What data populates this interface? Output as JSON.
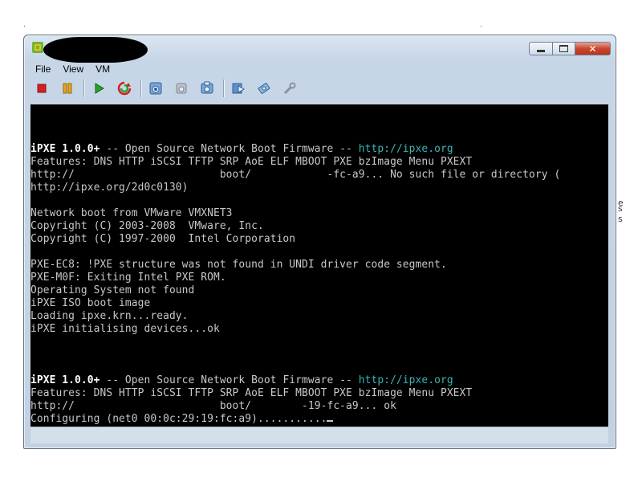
{
  "window": {
    "title_redacted": true,
    "controls": {
      "minimize": "minimize",
      "maximize": "maximize",
      "close": "✕"
    }
  },
  "menu": {
    "items": [
      "File",
      "View",
      "VM"
    ]
  },
  "toolbar": {
    "groups": [
      [
        {
          "name": "stop-icon",
          "color": "#d22020"
        },
        {
          "name": "pause-icon",
          "color": "#e09a10"
        }
      ],
      [
        {
          "name": "play-icon",
          "color": "#2aa12a"
        },
        {
          "name": "reset-icon",
          "color": "#cc2222"
        }
      ],
      [
        {
          "name": "snapshot-icon"
        },
        {
          "name": "revert-icon"
        },
        {
          "name": "snapshot-manager-icon"
        }
      ],
      [
        {
          "name": "ctrl-alt-del-icon"
        },
        {
          "name": "settings-icon"
        },
        {
          "name": "tools-icon"
        }
      ]
    ]
  },
  "console": {
    "lines": [
      {
        "row": 0,
        "segments": [
          {
            "text": "iPXE 1.0.0+",
            "style": "hl"
          },
          {
            "text": " -- Open Source Network Boot Firmware -- "
          },
          {
            "text": "http://ipxe.org",
            "style": "link"
          }
        ]
      },
      {
        "row": 1,
        "segments": [
          {
            "text": "Features: DNS HTTP iSCSI TFTP SRP AoE ELF MBOOT PXE bzImage Menu PXEXT"
          }
        ]
      },
      {
        "row": 2,
        "segments": [
          {
            "text": "http://                       boot/            -fc-a9... No such file or directory ("
          }
        ]
      },
      {
        "row": 3,
        "segments": [
          {
            "text": "http://ipxe.org/2d0c0130)"
          }
        ]
      },
      {
        "row": 5,
        "segments": [
          {
            "text": "Network boot from VMware VMXNET3"
          }
        ]
      },
      {
        "row": 6,
        "segments": [
          {
            "text": "Copyright (C) 2003-2008  VMware, Inc."
          }
        ]
      },
      {
        "row": 7,
        "segments": [
          {
            "text": "Copyright (C) 1997-2000  Intel Corporation"
          }
        ]
      },
      {
        "row": 9,
        "segments": [
          {
            "text": "PXE-EC8: !PXE structure was not found in UNDI driver code segment."
          }
        ]
      },
      {
        "row": 10,
        "segments": [
          {
            "text": "PXE-M0F: Exiting Intel PXE ROM."
          }
        ]
      },
      {
        "row": 11,
        "segments": [
          {
            "text": "Operating System not found"
          }
        ]
      },
      {
        "row": 12,
        "segments": [
          {
            "text": "iPXE ISO boot image"
          }
        ]
      },
      {
        "row": 13,
        "segments": [
          {
            "text": "Loading ipxe.krn...ready."
          }
        ]
      },
      {
        "row": 14,
        "segments": [
          {
            "text": "iPXE initialising devices...ok"
          }
        ]
      },
      {
        "row": 18,
        "segments": [
          {
            "text": "iPXE 1.0.0+",
            "style": "hl"
          },
          {
            "text": " -- Open Source Network Boot Firmware -- "
          },
          {
            "text": "http://ipxe.org",
            "style": "link"
          }
        ]
      },
      {
        "row": 19,
        "segments": [
          {
            "text": "Features: DNS HTTP iSCSI TFTP SRP AoE ELF MBOOT PXE bzImage Menu PXEXT"
          }
        ]
      },
      {
        "row": 20,
        "segments": [
          {
            "text": "http://                       boot/        -19-fc-a9... ok"
          }
        ]
      },
      {
        "row": 21,
        "segments": [
          {
            "text": "Configuring (net0 00:0c:29:19:fc:a9)..........."
          }
        ],
        "cursor": true
      }
    ]
  },
  "background": {
    "right_fragments": [
      "e",
      "s",
      "s"
    ]
  }
}
